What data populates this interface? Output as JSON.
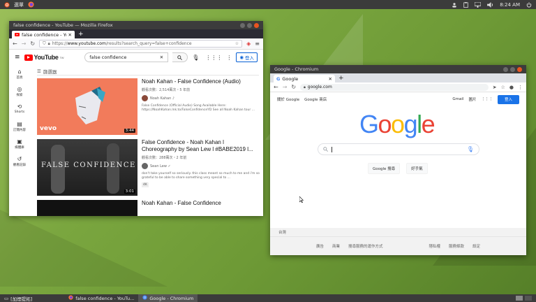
{
  "top_panel": {
    "menu_label": "選單",
    "clock": "8:24 AM"
  },
  "firefox": {
    "window_title": "false confidence - YouTube — Mozilla Firefox",
    "tab_title": "false confidence - YouTube",
    "url_scheme": "https://",
    "url_host": "www.youtube.com",
    "url_rest": "/results?search_query=false+confidence",
    "youtube": {
      "logo_text": "YouTube",
      "region": "TW",
      "search_value": "false confidence",
      "sign_in": "登入",
      "filter_label": "篩選器",
      "sidebar": [
        "首頁",
        "探索",
        "Shorts",
        "訂閱內容",
        "媒體庫",
        "觀看記錄"
      ],
      "videos": [
        {
          "title": "Noah Kahan - False Confidence (Audio)",
          "meta": "觀看次數：2,514萬次・5 年前",
          "channel": "Noah Kahan ♪",
          "desc": "False Confidence (Official Audio) Song Available Here: https://NoahKahan.lnk.to/FalseConfidenceYD See all Noah Kahan tour ...",
          "duration": "3:44",
          "thumb_brand": "vevo"
        },
        {
          "title": "False Confidence - Noah Kahan l Choreography by Sean Lew l #BABE2019 l...",
          "meta": "觀看次數：288萬次・2 年前",
          "channel": "Sean Lew ✓",
          "desc": "don't take yourself so seriously. this class meant so much to me and i'm so grateful to be able to share something very special to ...",
          "duration": "3:01",
          "badge": "4K",
          "thumb_text": "FALSE CONFIDENCE"
        },
        {
          "title": "Noah Kahan - False Confidence"
        }
      ]
    }
  },
  "chromium": {
    "window_title": "Google - Chromium",
    "tab_title": "Google",
    "url": "google.com",
    "google": {
      "about": "關於 Google",
      "store": "Google 商店",
      "gmail": "Gmail",
      "images": "圖片",
      "sign_in": "登入",
      "search_button": "Google 搜尋",
      "lucky_button": "好手氣",
      "country": "台灣",
      "footer_left": [
        "廣告",
        "商業",
        "搜尋服務的運作方式"
      ],
      "footer_right": [
        "隱私權",
        "服務條款",
        "設定"
      ]
    }
  },
  "taskbar": {
    "items": [
      "[加煙提拓]",
      "false confidence - YouTu...",
      "Google - Chromium"
    ]
  },
  "colors": {
    "yt_red": "#ff0000",
    "google_blue": "#4285f4",
    "google_red": "#ea4335",
    "google_yellow": "#fbbc05",
    "google_green": "#34a853",
    "ubuntu_orange": "#e95420"
  }
}
